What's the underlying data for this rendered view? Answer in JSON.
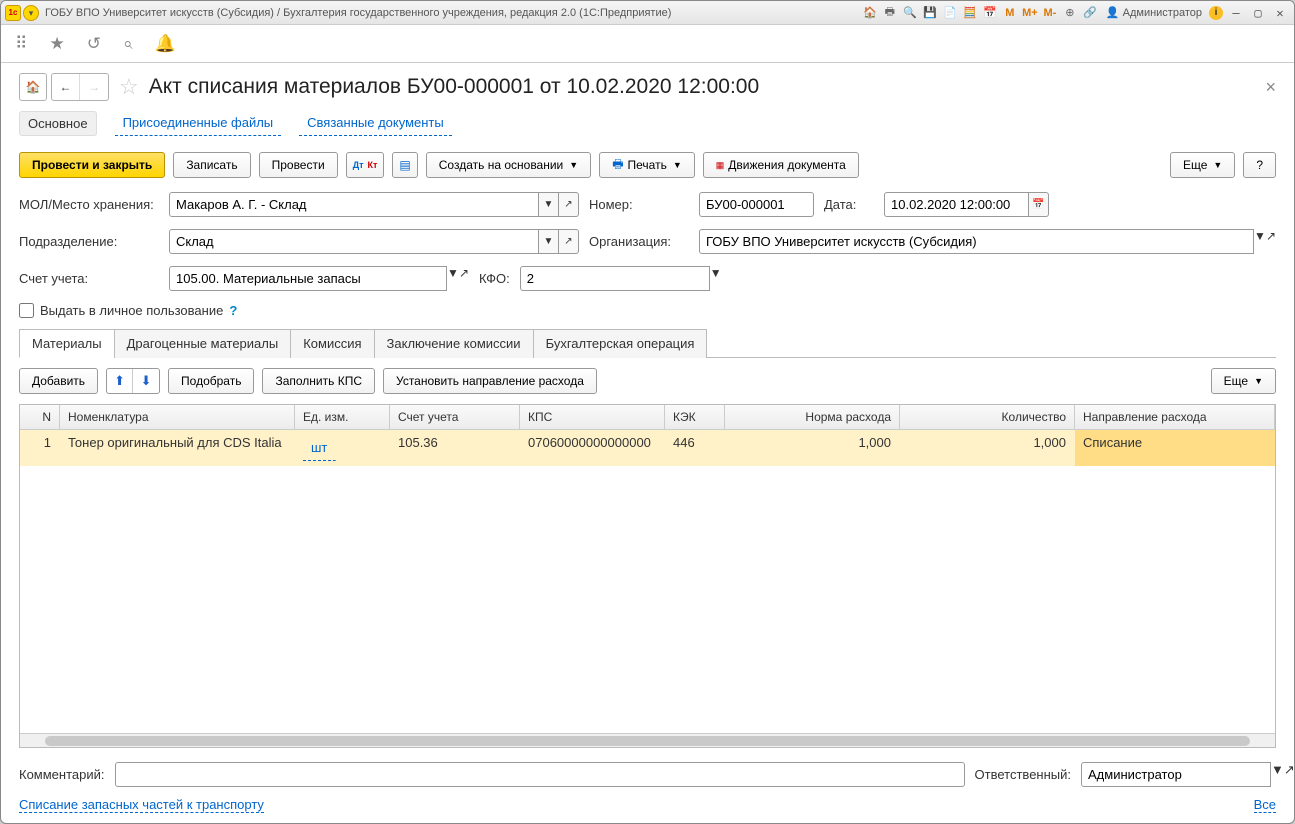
{
  "titlebar": {
    "text": "ГОБУ ВПО Университет искусств (Субсидия) / Бухгалтерия государственного учреждения, редакция 2.0  (1С:Предприятие)",
    "user": "Администратор",
    "icons": {
      "m": "M",
      "mplus": "M+",
      "mminus": "M-"
    }
  },
  "header": {
    "title": "Акт списания материалов БУ00-000001 от 10.02.2020 12:00:00"
  },
  "subnav": {
    "main": "Основное",
    "files": "Присоединенные файлы",
    "related": "Связанные документы"
  },
  "actions": {
    "post_close": "Провести и закрыть",
    "save": "Записать",
    "post": "Провести",
    "create_based": "Создать на основании",
    "print": "Печать",
    "movements": "Движения документа",
    "more": "Еще",
    "help": "?"
  },
  "form": {
    "mol_label": "МОЛ/Место хранения:",
    "mol_value": "Макаров А. Г. - Склад",
    "number_label": "Номер:",
    "number_value": "БУ00-000001",
    "date_label": "Дата:",
    "date_value": "10.02.2020 12:00:00",
    "division_label": "Подразделение:",
    "division_value": "Склад",
    "org_label": "Организация:",
    "org_value": "ГОБУ ВПО Университет искусств (Субсидия)",
    "account_label": "Счет учета:",
    "account_value": "105.00. Материальные запасы",
    "kfo_label": "КФО:",
    "kfo_value": "2",
    "personal_use": "Выдать в личное пользование"
  },
  "tabs": {
    "materials": "Материалы",
    "precious": "Драгоценные материалы",
    "commission": "Комиссия",
    "conclusion": "Заключение комиссии",
    "accounting": "Бухгалтерская операция"
  },
  "tab_toolbar": {
    "add": "Добавить",
    "pick": "Подобрать",
    "fill_kps": "Заполнить КПС",
    "set_direction": "Установить направление расхода",
    "more": "Еще"
  },
  "table": {
    "headers": {
      "n": "N",
      "nom": "Номенклатура",
      "unit": "Ед. изм.",
      "acct": "Счет учета",
      "kps": "КПС",
      "kek": "КЭК",
      "norm": "Норма расхода",
      "qty": "Количество",
      "dir": "Направление расхода"
    },
    "rows": [
      {
        "n": "1",
        "nom": "Тонер оригинальный для CDS Italia",
        "unit": "шт",
        "acct": "105.36",
        "kps": "07060000000000000",
        "kek": "446",
        "norm": "1,000",
        "qty": "1,000",
        "dir": "Списание"
      }
    ]
  },
  "footer": {
    "comment_label": "Комментарий:",
    "comment_value": "",
    "resp_label": "Ответственный:",
    "resp_value": "Администратор",
    "link": "Списание запасных частей к транспорту",
    "all": "Все"
  }
}
